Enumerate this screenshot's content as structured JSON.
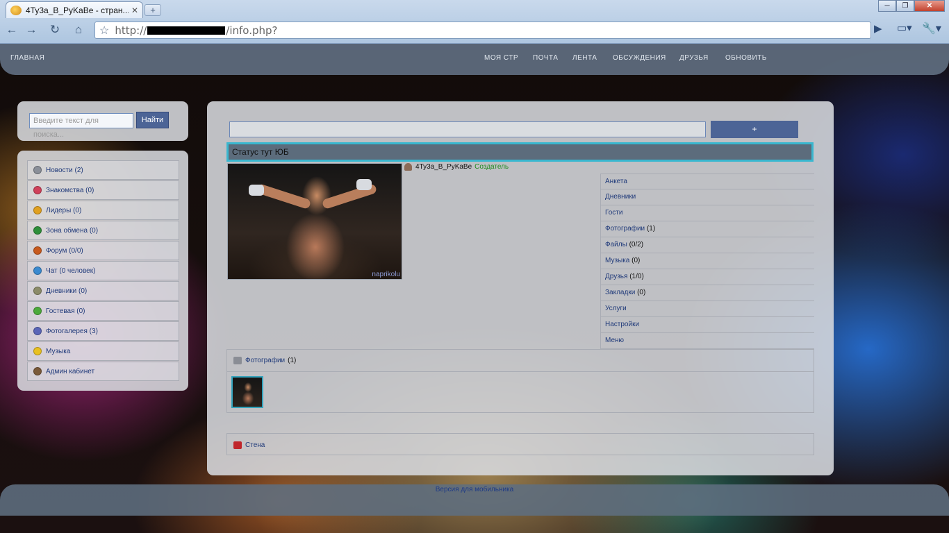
{
  "browser": {
    "tab_title": "4Ty3a_B_PyKaBe - стран...",
    "tab_close": "✕",
    "new_tab": "+",
    "url_prefix": "http://",
    "url_suffix": "/info.php?",
    "window_controls": [
      "─",
      "❐",
      "✕"
    ]
  },
  "topnav": {
    "home": "ГЛАВНАЯ",
    "items": [
      "МОЯ СТР",
      "ПОЧТА",
      "ЛЕНТА",
      "ОБСУЖДЕНИЯ",
      "ДРУЗЬЯ",
      "ОБНОВИТЬ"
    ]
  },
  "search": {
    "placeholder": "Введите текст для поиска...",
    "button": "Найти"
  },
  "sidebar": {
    "items": [
      {
        "label": "Новости (2)",
        "icon": "news-icon",
        "color": "#8a8f99"
      },
      {
        "label": "Знакомства (0)",
        "icon": "heart-icon",
        "color": "#d0405a"
      },
      {
        "label": "Лидеры (0)",
        "icon": "leaders-icon",
        "color": "#e0a020"
      },
      {
        "label": "Зона обмена (0)",
        "icon": "exchange-icon",
        "color": "#2e8f3a"
      },
      {
        "label": "Форум (0/0)",
        "icon": "forum-icon",
        "color": "#c85a1e"
      },
      {
        "label": "Чат (0 человек)",
        "icon": "chat-icon",
        "color": "#3a8ad0"
      },
      {
        "label": "Дневники (0)",
        "icon": "diary-icon",
        "color": "#8c8c6a"
      },
      {
        "label": "Гостевая (0)",
        "icon": "guestbook-icon",
        "color": "#4caa3c"
      },
      {
        "label": "Фотогалерея (3)",
        "icon": "gallery-icon",
        "color": "#5a66b8"
      },
      {
        "label": "Музыка",
        "icon": "music-icon",
        "color": "#e8c020"
      },
      {
        "label": "Админ кабинет",
        "icon": "admin-icon",
        "color": "#7a5a3a"
      }
    ]
  },
  "profile": {
    "add_button": "+",
    "status": "Статус тут ЮБ",
    "photo_watermark": "naprikolu",
    "nickname": "4Ty3a_B_PyKaBe",
    "role": "Создатель",
    "menu": [
      {
        "label": "Анкета",
        "count": ""
      },
      {
        "label": "Дневники",
        "count": ""
      },
      {
        "label": "Гости",
        "count": ""
      },
      {
        "label": "Фотографии",
        "count": "(1)"
      },
      {
        "label": "Файлы",
        "count": "(0/2)"
      },
      {
        "label": "Музыка",
        "count": "(0)"
      },
      {
        "label": "Друзья",
        "count": "(1/0)"
      },
      {
        "label": "Закладки",
        "count": "(0)"
      },
      {
        "label": "Услуги",
        "count": ""
      },
      {
        "label": "Настройки",
        "count": ""
      },
      {
        "label": "Меню",
        "count": ""
      }
    ],
    "photos_label": "Фотографии",
    "photos_count": "(1)",
    "wall_label": "Стена"
  },
  "footer": {
    "mobile_link": "Версия для мобильника"
  },
  "colors": {
    "accent_button": "#4c6496",
    "status_border": "#39b7cf",
    "link": "#203a7a",
    "creator": "#1e8a1e"
  }
}
